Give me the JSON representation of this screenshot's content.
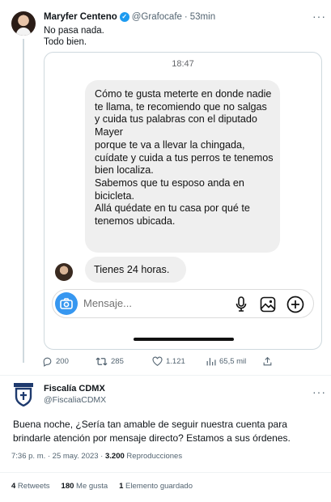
{
  "tweet1": {
    "author_name": "Maryfer Centeno",
    "handle": "@Grafocafe",
    "separator": "·",
    "time_ago": "53min",
    "more": "···",
    "lines": [
      "No pasa nada.",
      "Todo bien."
    ]
  },
  "dm_screenshot": {
    "time": "18:47",
    "message_lines": [
      "Cómo te gusta meterte en donde nadie te llama, te recomiendo que no salgas y cuida tus palabras con el diputado Mayer",
      "porque te va a llevar la chingada, cuídate y cuida a tus perros te tenemos bien localiza.",
      "Sabemos  que tu esposo anda en bicicleta.",
      "Allá quédate en tu casa por qué te tenemos ubicada."
    ],
    "short_message": "Tienes 24 horas.",
    "composer_placeholder": "Mensaje..."
  },
  "actions": {
    "replies": "200",
    "retweets": "285",
    "likes": "1.121",
    "views": "65,5 mil"
  },
  "tweet2": {
    "author_name": "Fiscalía CDMX",
    "handle": "@FiscaliaCDMX",
    "more": "···",
    "text": "Buena noche, ¿Sería tan amable de seguir nuestra cuenta para brindarle atención por mensaje directo? Estamos a sus órdenes.",
    "timestamp": "7:36 p. m. · 25 may. 2023 · ",
    "views_count": "3.200",
    "views_label": " Reproducciones"
  },
  "stats": {
    "retweets_count": "4",
    "retweets_label": " Retweets",
    "likes_count": "180",
    "likes_label": " Me gusta",
    "saved_count": "1",
    "saved_label": " Elemento guardado"
  },
  "colors": {
    "accent": "#1d9bf0",
    "camera_button": "#3797f0",
    "secondary_text": "#536471"
  },
  "icons": [
    "verified-icon",
    "camera-icon",
    "microphone-icon",
    "image-icon",
    "plus-circle-icon",
    "reply-icon",
    "retweet-icon",
    "like-icon",
    "views-icon",
    "share-icon",
    "fiscalia-logo"
  ]
}
